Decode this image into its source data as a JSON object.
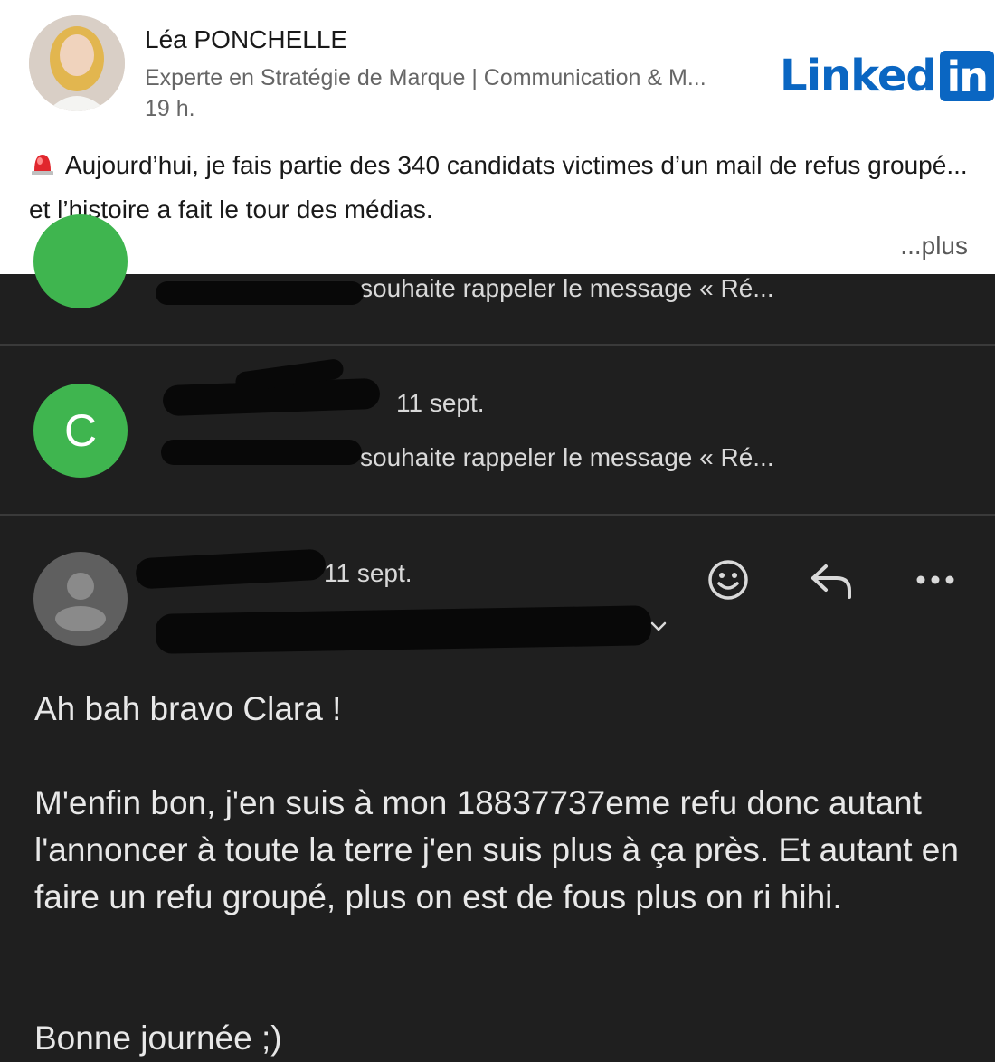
{
  "post": {
    "author_name": "Léa PONCHELLE",
    "author_headline": "Experte en Stratégie de Marque | Communication & M...",
    "age": "19 h.",
    "text": "Aujourd’hui, je fais partie des 340 candidats victimes d’un mail de refus groupé... et l’histoire a fait le tour des médias.",
    "see_more": "...plus",
    "logo_word": "Linked",
    "logo_box": "in",
    "brand_color": "#0a66c2"
  },
  "email": {
    "row1": {
      "preview": "souhaite rappeler le message « Ré..."
    },
    "row2": {
      "avatar_letter": "C",
      "date": "11 sept.",
      "preview": "souhaite rappeler le message « Ré..."
    },
    "open_message": {
      "date": "11 sept.",
      "body": {
        "greeting": "Ah bah bravo Clara !",
        "paragraph": "M'enfin bon, j'en suis à mon 18837737eme refu donc autant l'annoncer à toute la terre j'en suis plus à ça près. Et autant en faire un refu groupé, plus on est de fous plus on ri hihi.",
        "signoff": "Bonne journée ;)"
      }
    },
    "icons": [
      "emoji-icon",
      "reply-icon",
      "more-icon",
      "chevron-down-icon"
    ],
    "avatar_green": "#3fb54f"
  }
}
